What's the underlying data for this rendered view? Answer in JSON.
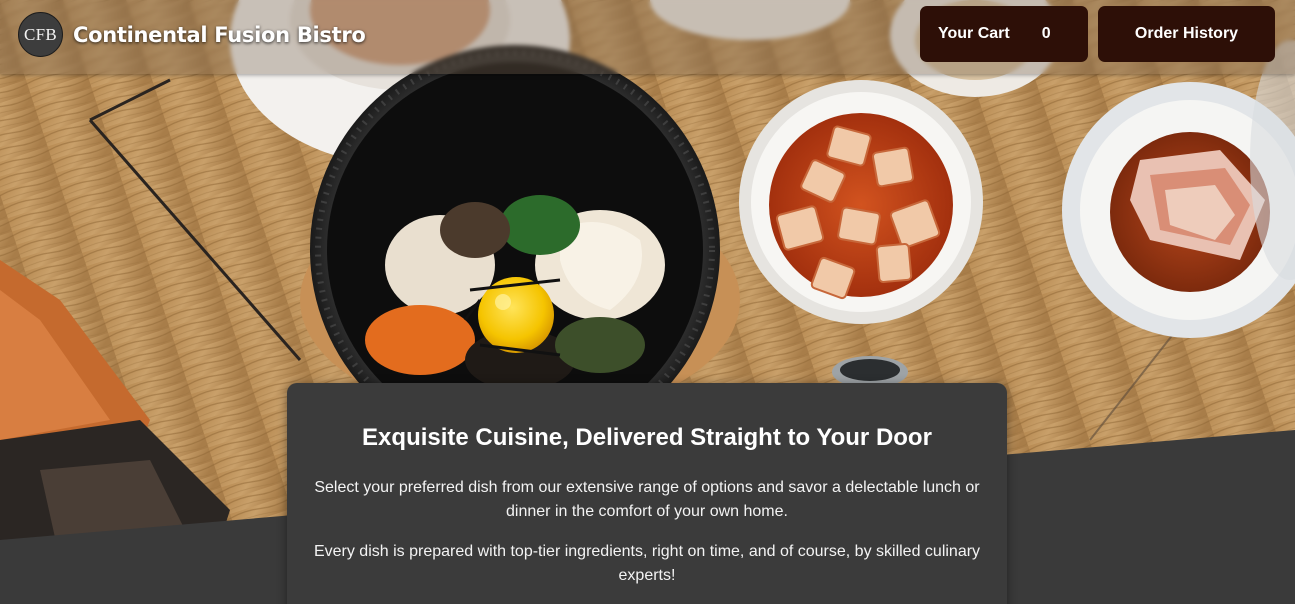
{
  "header": {
    "logo_text": "CFB",
    "brand_name": "Continental Fusion Bistro",
    "cart_label": "Your Cart",
    "cart_count": "0",
    "order_history_label": "Order History"
  },
  "hero": {
    "image_subject": "food-photo"
  },
  "card": {
    "title": "Exquisite Cuisine, Delivered Straight to Your Door",
    "paragraph_1": "Select your preferred dish from our extensive range of options and savor a delectable lunch or dinner in the comfort of your own home.",
    "paragraph_2": "Every dish is prepared with top-tier ingredients, right on time, and of course, by skilled culinary experts!"
  },
  "colors": {
    "button_bg": "#2d0f07",
    "card_bg": "#3b3b3b",
    "page_bg": "#3a3a3a"
  }
}
